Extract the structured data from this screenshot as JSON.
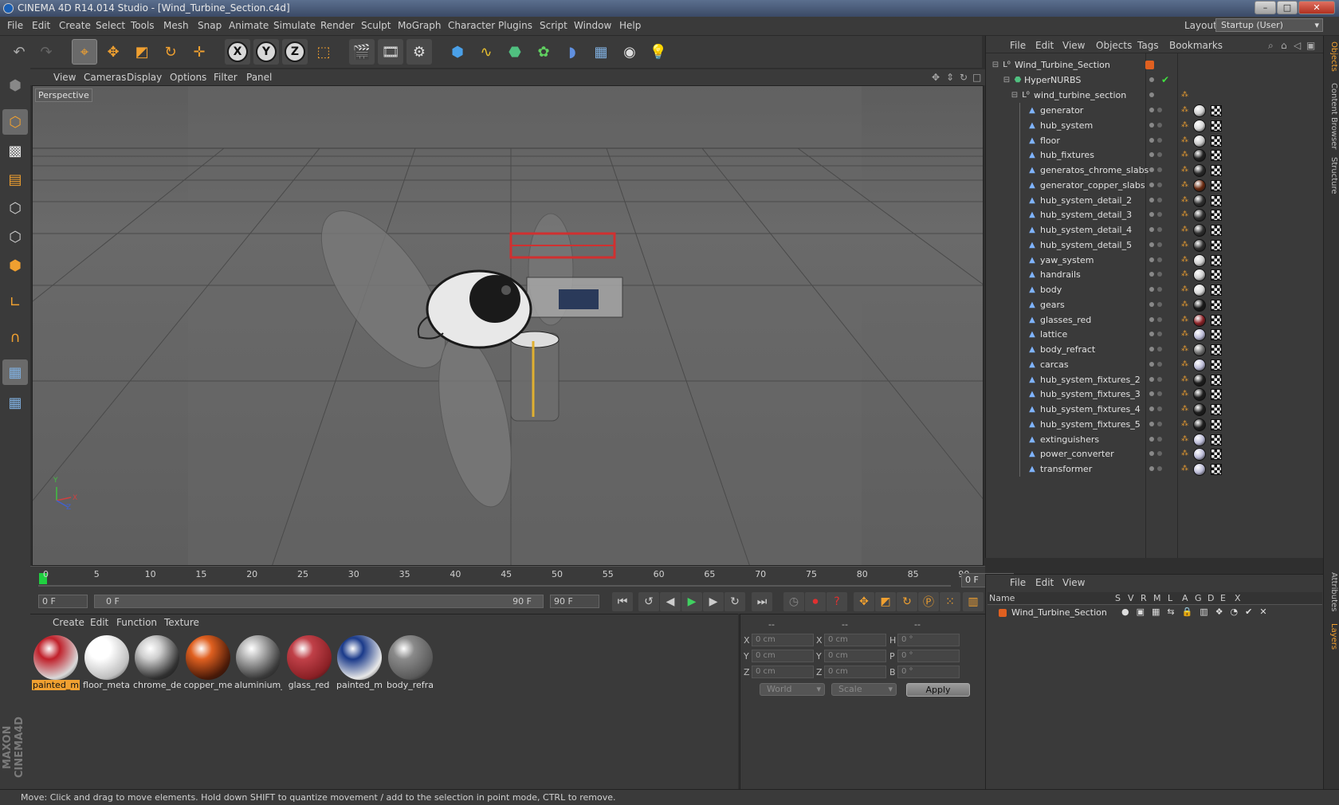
{
  "window": {
    "title": "CINEMA 4D R14.014 Studio - [Wind_Turbine_Section.c4d]",
    "minimize": "–",
    "maximize": "□",
    "close": "✕"
  },
  "menubar": {
    "items": [
      "File",
      "Edit",
      "Create",
      "Select",
      "Tools",
      "Mesh",
      "Snap",
      "Animate",
      "Simulate",
      "Render",
      "Sculpt",
      "MoGraph",
      "Character",
      "Plugins",
      "Script",
      "Window",
      "Help"
    ],
    "layout_label": "Layout:",
    "layout_value": "Startup (User)"
  },
  "toolbar": {
    "axes": [
      "X",
      "Y",
      "Z"
    ]
  },
  "viewport": {
    "menu": [
      "View",
      "Cameras",
      "Display",
      "Options",
      "Filter",
      "Panel"
    ],
    "label": "Perspective",
    "axis_x": "X",
    "axis_y": "Y",
    "axis_z": "Z"
  },
  "timeline": {
    "ticks": [
      "0",
      "5",
      "10",
      "15",
      "20",
      "25",
      "30",
      "35",
      "40",
      "45",
      "50",
      "55",
      "60",
      "65",
      "70",
      "75",
      "80",
      "85",
      "90"
    ],
    "current_frame": "0 F",
    "start_field": "0 F",
    "range_start": "0 F",
    "range_end": "90 F",
    "end_field": "90 F"
  },
  "material_manager": {
    "menu": [
      "Create",
      "Edit",
      "Function",
      "Texture"
    ],
    "materials": [
      {
        "name": "painted_m",
        "color": "#d9d9d9",
        "accent": "#c0202a",
        "selected": true
      },
      {
        "name": "floor_meta",
        "color": "#bfbfbf",
        "accent": "#ffffff",
        "selected": false
      },
      {
        "name": "chrome_de",
        "color": "#303030",
        "accent": "#cfcfcf",
        "selected": false
      },
      {
        "name": "copper_me",
        "color": "#4a1a08",
        "accent": "#e06020",
        "selected": false
      },
      {
        "name": "aluminium_",
        "color": "#3a3a3a",
        "accent": "#b8b8b8",
        "selected": false
      },
      {
        "name": "glass_red",
        "color": "#8a2025",
        "accent": "#c04048",
        "selected": false
      },
      {
        "name": "painted_m",
        "color": "#e8e8e8",
        "accent": "#1a3a8a",
        "selected": false
      },
      {
        "name": "body_refra",
        "color": "#5a5a5a",
        "accent": "#8a8a8a",
        "selected": false
      }
    ]
  },
  "coordinates": {
    "header": [
      "--",
      "--",
      "--"
    ],
    "rows": [
      {
        "l1": "X",
        "v1": "0 cm",
        "l2": "X",
        "v2": "0 cm",
        "l3": "H",
        "v3": "0 °"
      },
      {
        "l1": "Y",
        "v1": "0 cm",
        "l2": "Y",
        "v2": "0 cm",
        "l3": "P",
        "v3": "0 °"
      },
      {
        "l1": "Z",
        "v1": "0 cm",
        "l2": "Z",
        "v2": "0 cm",
        "l3": "B",
        "v3": "0 °"
      }
    ],
    "mode": "World",
    "scale": "Scale",
    "apply": "Apply"
  },
  "object_manager": {
    "menu": [
      "File",
      "Edit",
      "View",
      "Objects",
      "Tags",
      "Bookmarks"
    ],
    "root": "Wind_Turbine_Section",
    "hypernurbs": "HyperNURBS",
    "section": "wind_turbine_section",
    "objects": [
      {
        "name": "generator",
        "tag": "#cfcfcf"
      },
      {
        "name": "hub_system",
        "tag": "#d8d8d8"
      },
      {
        "name": "floor",
        "tag": "#c8c8c8"
      },
      {
        "name": "hub_fixtures",
        "tag": "#222222"
      },
      {
        "name": "generatos_chrome_slabs",
        "tag": "#2a2a2a"
      },
      {
        "name": "generator_copper_slabs",
        "tag": "#6a2a10"
      },
      {
        "name": "hub_system_detail_2",
        "tag": "#303030"
      },
      {
        "name": "hub_system_detail_3",
        "tag": "#303030"
      },
      {
        "name": "hub_system_detail_4",
        "tag": "#303030"
      },
      {
        "name": "hub_system_detail_5",
        "tag": "#303030"
      },
      {
        "name": "yaw_system",
        "tag": "#cfcfcf"
      },
      {
        "name": "handrails",
        "tag": "#d0d0d0"
      },
      {
        "name": "body",
        "tag": "#d8d8d8"
      },
      {
        "name": "gears",
        "tag": "#1a1a1a"
      },
      {
        "name": "glasses_red",
        "tag": "#8a2025"
      },
      {
        "name": "lattice",
        "tag": "#bcbcd8"
      },
      {
        "name": "body_refract",
        "tag": "#707070"
      },
      {
        "name": "carcas",
        "tag": "#bcbcd8"
      },
      {
        "name": "hub_system_fixtures_2",
        "tag": "#1e1e1e"
      },
      {
        "name": "hub_system_fixtures_3",
        "tag": "#1e1e1e"
      },
      {
        "name": "hub_system_fixtures_4",
        "tag": "#1e1e1e"
      },
      {
        "name": "hub_system_fixtures_5",
        "tag": "#1e1e1e"
      },
      {
        "name": "extinguishers",
        "tag": "#bcbcd8"
      },
      {
        "name": "power_converter",
        "tag": "#bcbcd8"
      },
      {
        "name": "transformer",
        "tag": "#bcbcd8"
      }
    ]
  },
  "attribute_manager": {
    "menu": [
      "File",
      "Edit",
      "View"
    ],
    "columns": [
      "Name",
      "S",
      "V",
      "R",
      "M",
      "L",
      "A",
      "G",
      "D",
      "E",
      "X"
    ],
    "row_name": "Wind_Turbine_Section"
  },
  "right_tabs": [
    "Objects",
    "Content Browser",
    "Structure",
    "Attributes",
    "Layers"
  ],
  "status": "Move: Click and drag to move elements. Hold down SHIFT to quantize movement / add to the selection in point mode, CTRL to remove.",
  "colors": {
    "accent": "#f0a030",
    "background": "#3a3a3a"
  }
}
